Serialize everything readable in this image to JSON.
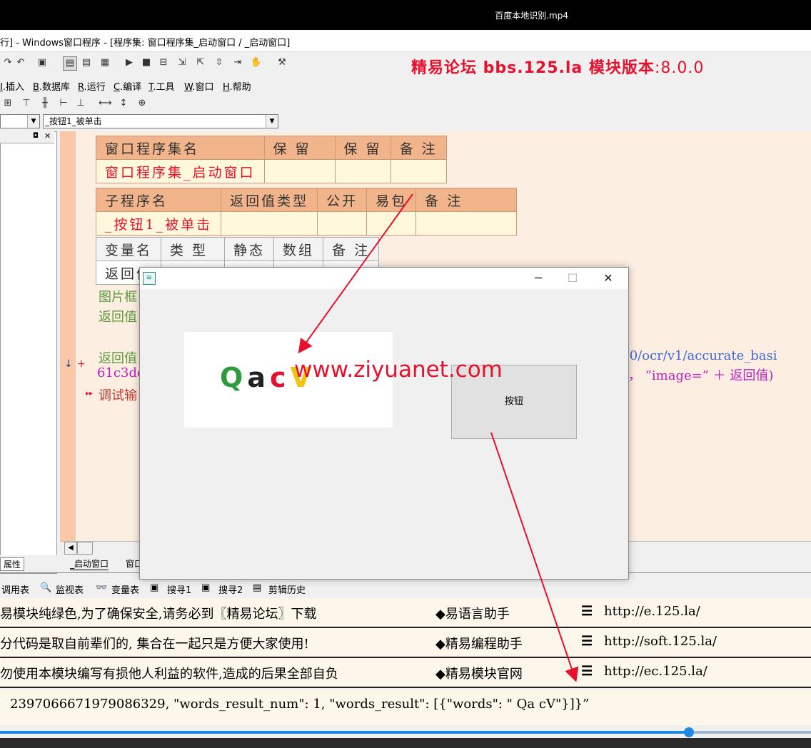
{
  "video": {
    "title": "百度本地识别.mp4"
  },
  "window": {
    "title": "行] - Windows窗口程序 - [程序集: 窗口程序集_启动窗口 / _启动窗口]"
  },
  "banner": {
    "brand": "精易论坛 bbs.125.la 模块版本",
    "version": ":8.0.0"
  },
  "menu": {
    "items": [
      {
        "key": "I",
        "label": ".插入"
      },
      {
        "key": "B",
        "label": ".数据库"
      },
      {
        "key": "R",
        "label": ".运行"
      },
      {
        "key": "C",
        "label": ".编译"
      },
      {
        "key": "T",
        "label": ".工具"
      },
      {
        "key": "W",
        "label": ".窗口"
      },
      {
        "key": "H",
        "label": ".帮助"
      }
    ]
  },
  "combo": {
    "right": "_按钮1_被单击"
  },
  "editor": {
    "assembly_table": {
      "headers": [
        "窗口程序集名",
        "保 留",
        "保 留",
        "备 注"
      ],
      "values": [
        "窗口程序集_启动窗口",
        "",
        "",
        ""
      ]
    },
    "sub_table": {
      "headers": [
        "子程序名",
        "返回值类型",
        "公开",
        "易包",
        "备 注"
      ],
      "values": [
        "_按钮1_被单击",
        "",
        "",
        "",
        ""
      ]
    },
    "var_table": {
      "headers": [
        "变量名",
        "类 型",
        "静态",
        "数组",
        "备 注"
      ],
      "values": [
        "返回值",
        "",
        "",
        "",
        ""
      ]
    },
    "code": {
      "line1": "图片框",
      "line2": "返回值",
      "line3": "返回值",
      "line3_right": ".0/ocr/v1/accurate_basi",
      "line4": "61c3dc",
      "line4_right": "， “image=” ＋ 返回值)",
      "line5": "调试输"
    }
  },
  "tabs": {
    "properties": "属性",
    "tab1": "_启动窗口",
    "tab2": "窗口"
  },
  "bottom_tabs": [
    "调用表",
    "监视表",
    "变量表",
    "搜寻1",
    "搜寻2",
    "剪辑历史"
  ],
  "messages": [
    {
      "left": "易模块纯绿色,为了确保安全,请务必到〖精易论坛〗下载",
      "middle": "◆易语言助手",
      "url": "http://e.125.la/"
    },
    {
      "left": "分代码是取自前辈们的, 集合在一起只是方便大家使用!",
      "middle": "◆精易编程助手",
      "url": "http://soft.125.la/"
    },
    {
      "left": "勿使用本模块编写有损他人利益的软件,造成的后果全部自负",
      "middle": "◆精易模块官网",
      "url": "http://ec.125.la/"
    }
  ],
  "result": {
    "text": "2397066671979086329, \"words_result_num\": 1, \"words_result\": [{\"words\": \" Qa cV\"}]}”"
  },
  "dialog": {
    "captcha_chars": [
      "Q",
      "a",
      "c",
      "V"
    ],
    "button_label": "按钮",
    "watermark": "www.ziyuanet.com"
  },
  "colors": {
    "accent_red": "#e8112d",
    "table_header": "#f2b58b",
    "progress": "#1e88e5"
  }
}
